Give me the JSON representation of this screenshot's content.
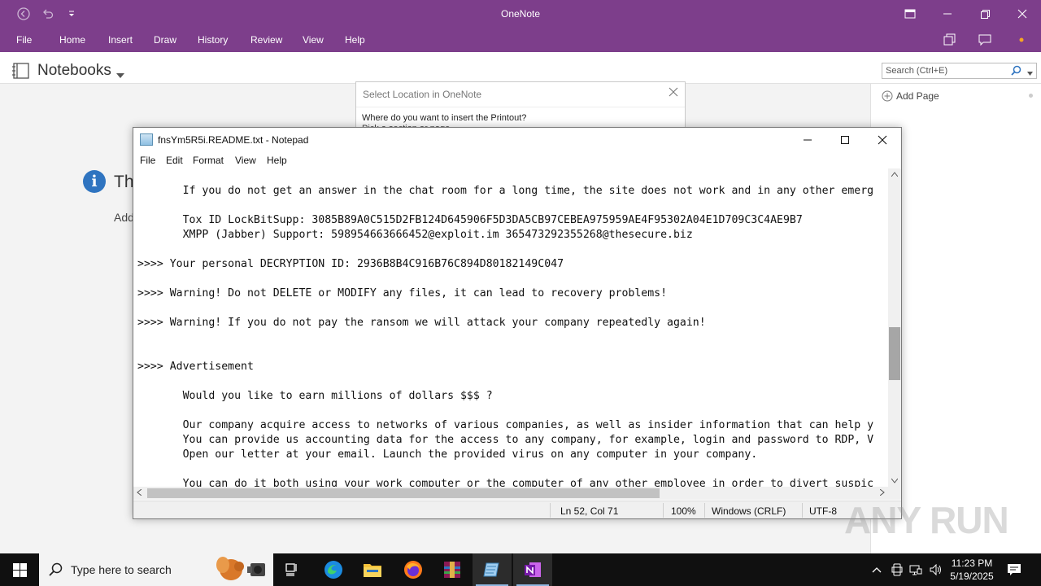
{
  "onenote": {
    "title": "OneNote",
    "menu": [
      "File",
      "Home",
      "Insert",
      "Draw",
      "History",
      "Review",
      "View",
      "Help"
    ],
    "notebooks_label": "Notebooks",
    "search_placeholder": "Search (Ctrl+E)",
    "add_page": "Add Page",
    "info_text": "Th",
    "info_sub": "Add"
  },
  "select_dialog": {
    "title": "Select Location in OneNote",
    "question": "Where do you want to insert the Printout?",
    "pick": "Pick a section or page"
  },
  "notepad": {
    "title": "fnsYm5R5i.README.txt - Notepad",
    "menu": [
      "File",
      "Edit",
      "Format",
      "View",
      "Help"
    ],
    "lines": [
      "       If you do not get an answer in the chat room for a long time, the site does not work and in any other emerg",
      "",
      "       Tox ID LockBitSupp: 3085B89A0C515D2FB124D645906F5D3DA5CB97CEBEA975959AE4F95302A04E1D709C3C4AE9B7",
      "       XMPP (Jabber) Support: 598954663666452@exploit.im 365473292355268@thesecure.biz",
      "",
      ">>>> Your personal DECRYPTION ID: 2936B8B4C916B76C894D80182149C047",
      "",
      ">>>> Warning! Do not DELETE or MODIFY any files, it can lead to recovery problems!",
      "",
      ">>>> Warning! If you do not pay the ransom we will attack your company repeatedly again!",
      "",
      "",
      ">>>> Advertisement",
      "",
      "       Would you like to earn millions of dollars $$$ ?",
      "",
      "       Our company acquire access to networks of various companies, as well as insider information that can help y",
      "       You can provide us accounting data for the access to any company, for example, login and password to RDP, V",
      "       Open our letter at your email. Launch the provided virus on any computer in your company.",
      "",
      "       You can do it both using your work computer or the computer of any other employee in order to divert suspic"
    ],
    "status": {
      "position": "Ln 52, Col 71",
      "zoom": "100%",
      "line_ending": "Windows (CRLF)",
      "encoding": "UTF-8"
    }
  },
  "watermark": "ANY RUN",
  "taskbar": {
    "search_placeholder": "Type here to search",
    "time": "11:23 PM",
    "date": "5/19/2025"
  }
}
